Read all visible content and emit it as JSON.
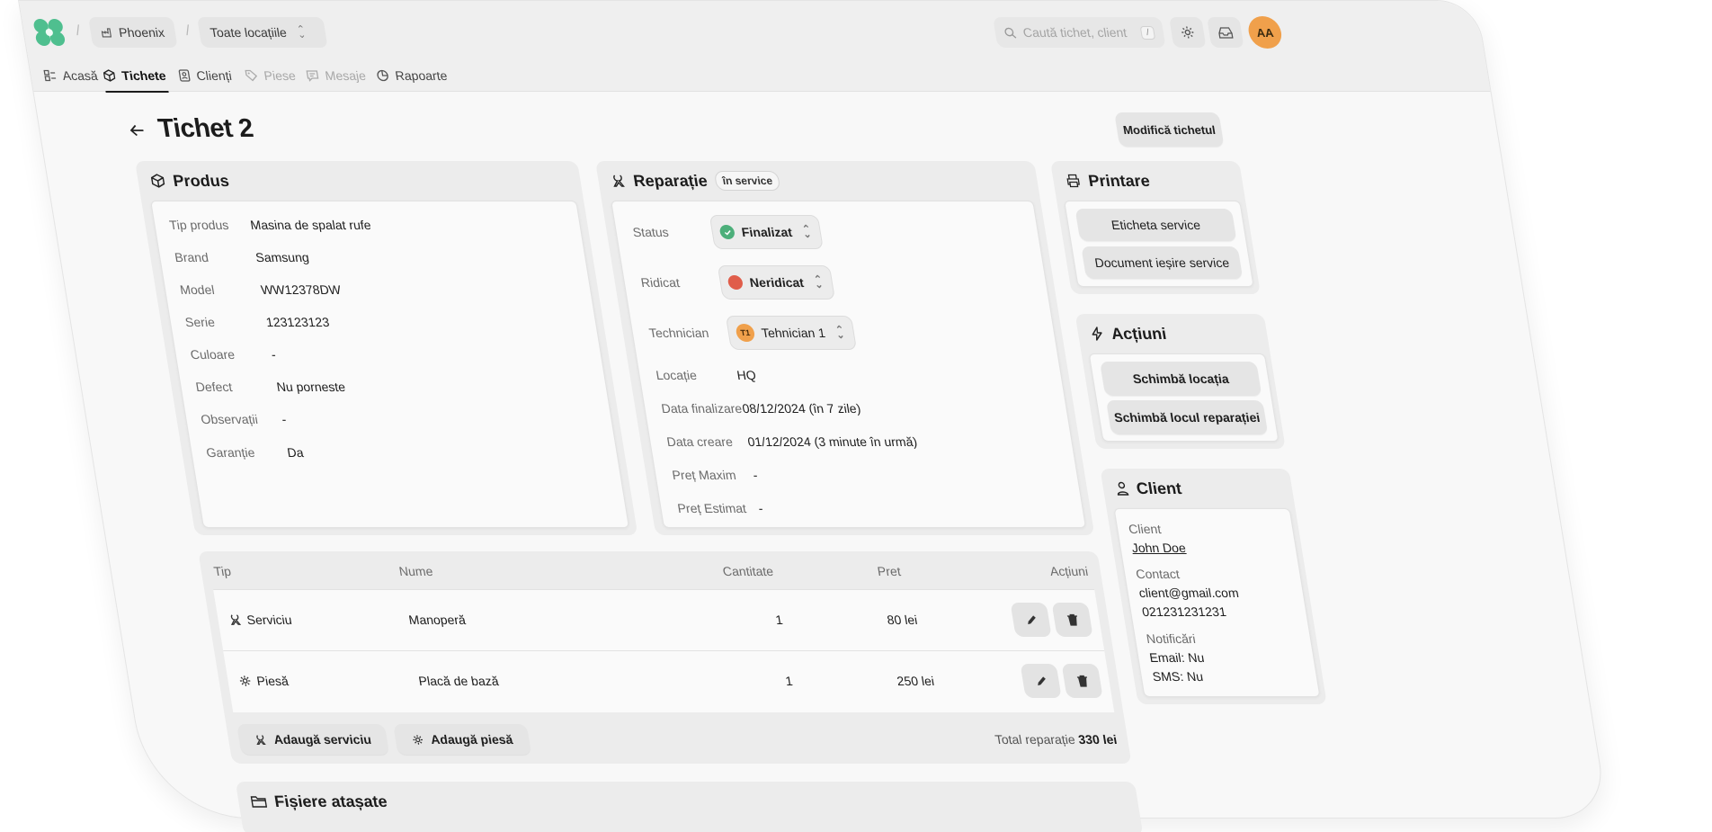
{
  "header": {
    "org": "Phoenix",
    "location": "Toate locațiile",
    "search_placeholder": "Caută tichet, client",
    "search_shortcut": "/",
    "avatar_initials": "AA"
  },
  "tabs": [
    {
      "label": "Acasă",
      "icon": "home-icon",
      "state": "normal"
    },
    {
      "label": "Tichete",
      "icon": "box-icon",
      "state": "active"
    },
    {
      "label": "Clienți",
      "icon": "contacts-icon",
      "state": "normal"
    },
    {
      "label": "Piese",
      "icon": "tag-icon",
      "state": "disabled"
    },
    {
      "label": "Mesaje",
      "icon": "message-icon",
      "state": "disabled"
    },
    {
      "label": "Rapoarte",
      "icon": "chart-icon",
      "state": "normal"
    }
  ],
  "page": {
    "title": "Tichet 2",
    "edit_button": "Modifică tichetul"
  },
  "product": {
    "title": "Produs",
    "fields": [
      {
        "label": "Tip produs",
        "value": "Masina de spalat rufe"
      },
      {
        "label": "Brand",
        "value": "Samsung"
      },
      {
        "label": "Model",
        "value": "WW12378DW"
      },
      {
        "label": "Serie",
        "value": "123123123"
      },
      {
        "label": "Culoare",
        "value": "-"
      },
      {
        "label": "Defect",
        "value": "Nu porneste"
      },
      {
        "label": "Observații",
        "value": "-"
      },
      {
        "label": "Garanție",
        "value": "Da"
      }
    ]
  },
  "repair": {
    "title": "Reparație",
    "badge": "în service",
    "status": {
      "label": "Status",
      "value": "Finalizat",
      "color": "#4caf7a"
    },
    "pickup": {
      "label": "Ridicat",
      "value": "Neridicat",
      "color": "#e05d4a"
    },
    "technician": {
      "label": "Technician",
      "value": "Tehnician 1",
      "initials": "T1",
      "color": "#f0a04b"
    },
    "location": {
      "label": "Locație",
      "value": "HQ"
    },
    "finish_date": {
      "label": "Data finalizare",
      "value": "08/12/2024 (în 7 zile)"
    },
    "created_date": {
      "label": "Data creare",
      "value": "01/12/2024 (3 minute în urmă)"
    },
    "max_price": {
      "label": "Preț Maxim",
      "value": "-"
    },
    "est_price": {
      "label": "Preț Estimat",
      "value": "-"
    }
  },
  "print": {
    "title": "Printare",
    "buttons": [
      "Eticheta service",
      "Document ieșire service"
    ]
  },
  "actions": {
    "title": "Acțiuni",
    "buttons": [
      "Schimbă locația",
      "Schimbă locul reparației"
    ]
  },
  "client": {
    "title": "Client",
    "client_label": "Client",
    "name": "John Doe",
    "contact_label": "Contact",
    "email": "client@gmail.com",
    "phone": "021231231231",
    "notif_label": "Notificări",
    "notif_email": "Email: Nu",
    "notif_sms": "SMS: Nu"
  },
  "items": {
    "headers": [
      "Tip",
      "Nume",
      "Cantitate",
      "Pret",
      "Acțiuni"
    ],
    "rows": [
      {
        "type": "Serviciu",
        "type_icon": "wrench-icon",
        "name": "Manoperă",
        "qty": "1",
        "price": "80 lei"
      },
      {
        "type": "Piesă",
        "type_icon": "cog-icon",
        "name": "Placă de bază",
        "qty": "1",
        "price": "250 lei"
      }
    ],
    "add_service": "Adaugă serviciu",
    "add_part": "Adaugă piesă",
    "total_label": "Total reparație",
    "total_value": "330 lei"
  },
  "files": {
    "title": "Fișiere atașate"
  }
}
